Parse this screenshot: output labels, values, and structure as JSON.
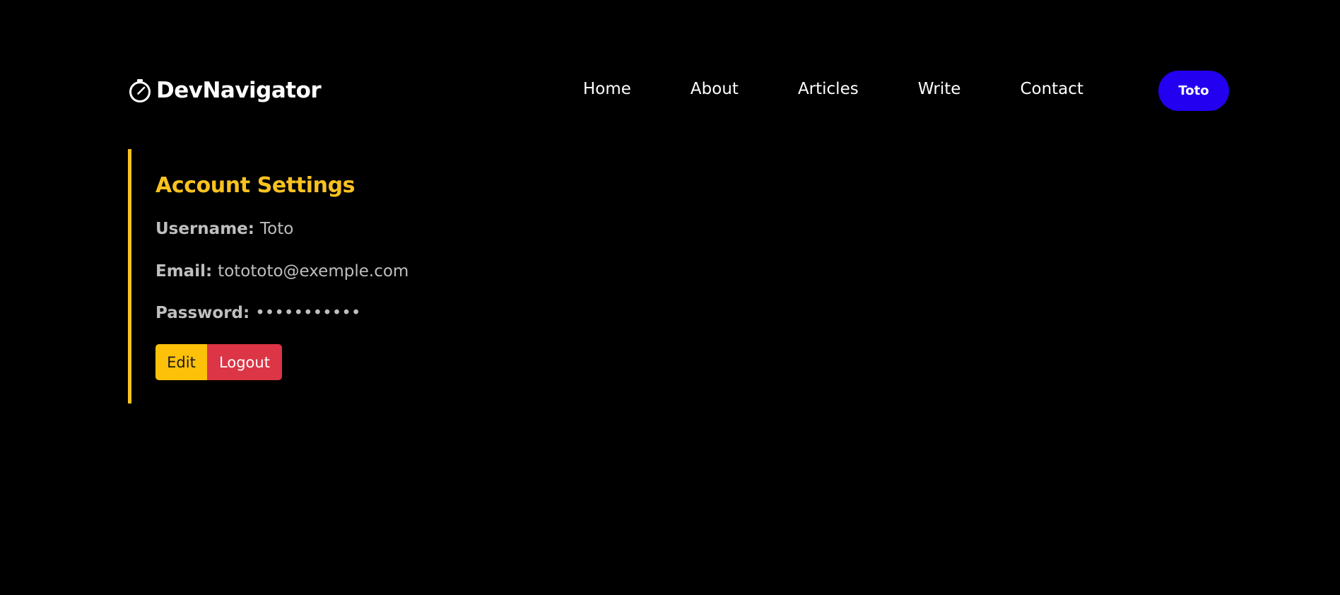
{
  "header": {
    "brand": {
      "icon": "compass-icon",
      "name": "DevNavigator"
    },
    "nav": {
      "items": [
        {
          "label": "Home"
        },
        {
          "label": "About"
        },
        {
          "label": "Articles"
        },
        {
          "label": "Write"
        },
        {
          "label": "Contact"
        }
      ]
    },
    "user_button": {
      "label": "Toto",
      "color": "#2300f0"
    }
  },
  "account": {
    "title": "Account Settings",
    "accent_color": "#f8c21f",
    "username": {
      "label": "Username:",
      "value": "Toto"
    },
    "email": {
      "label": "Email:",
      "value": "totototo@exemple.com"
    },
    "password": {
      "label": "Password:",
      "value": "•••••••••••"
    },
    "actions": {
      "edit_label": "Edit",
      "edit_color": "#fdc10a",
      "logout_label": "Logout",
      "logout_color": "#dc3545"
    }
  }
}
